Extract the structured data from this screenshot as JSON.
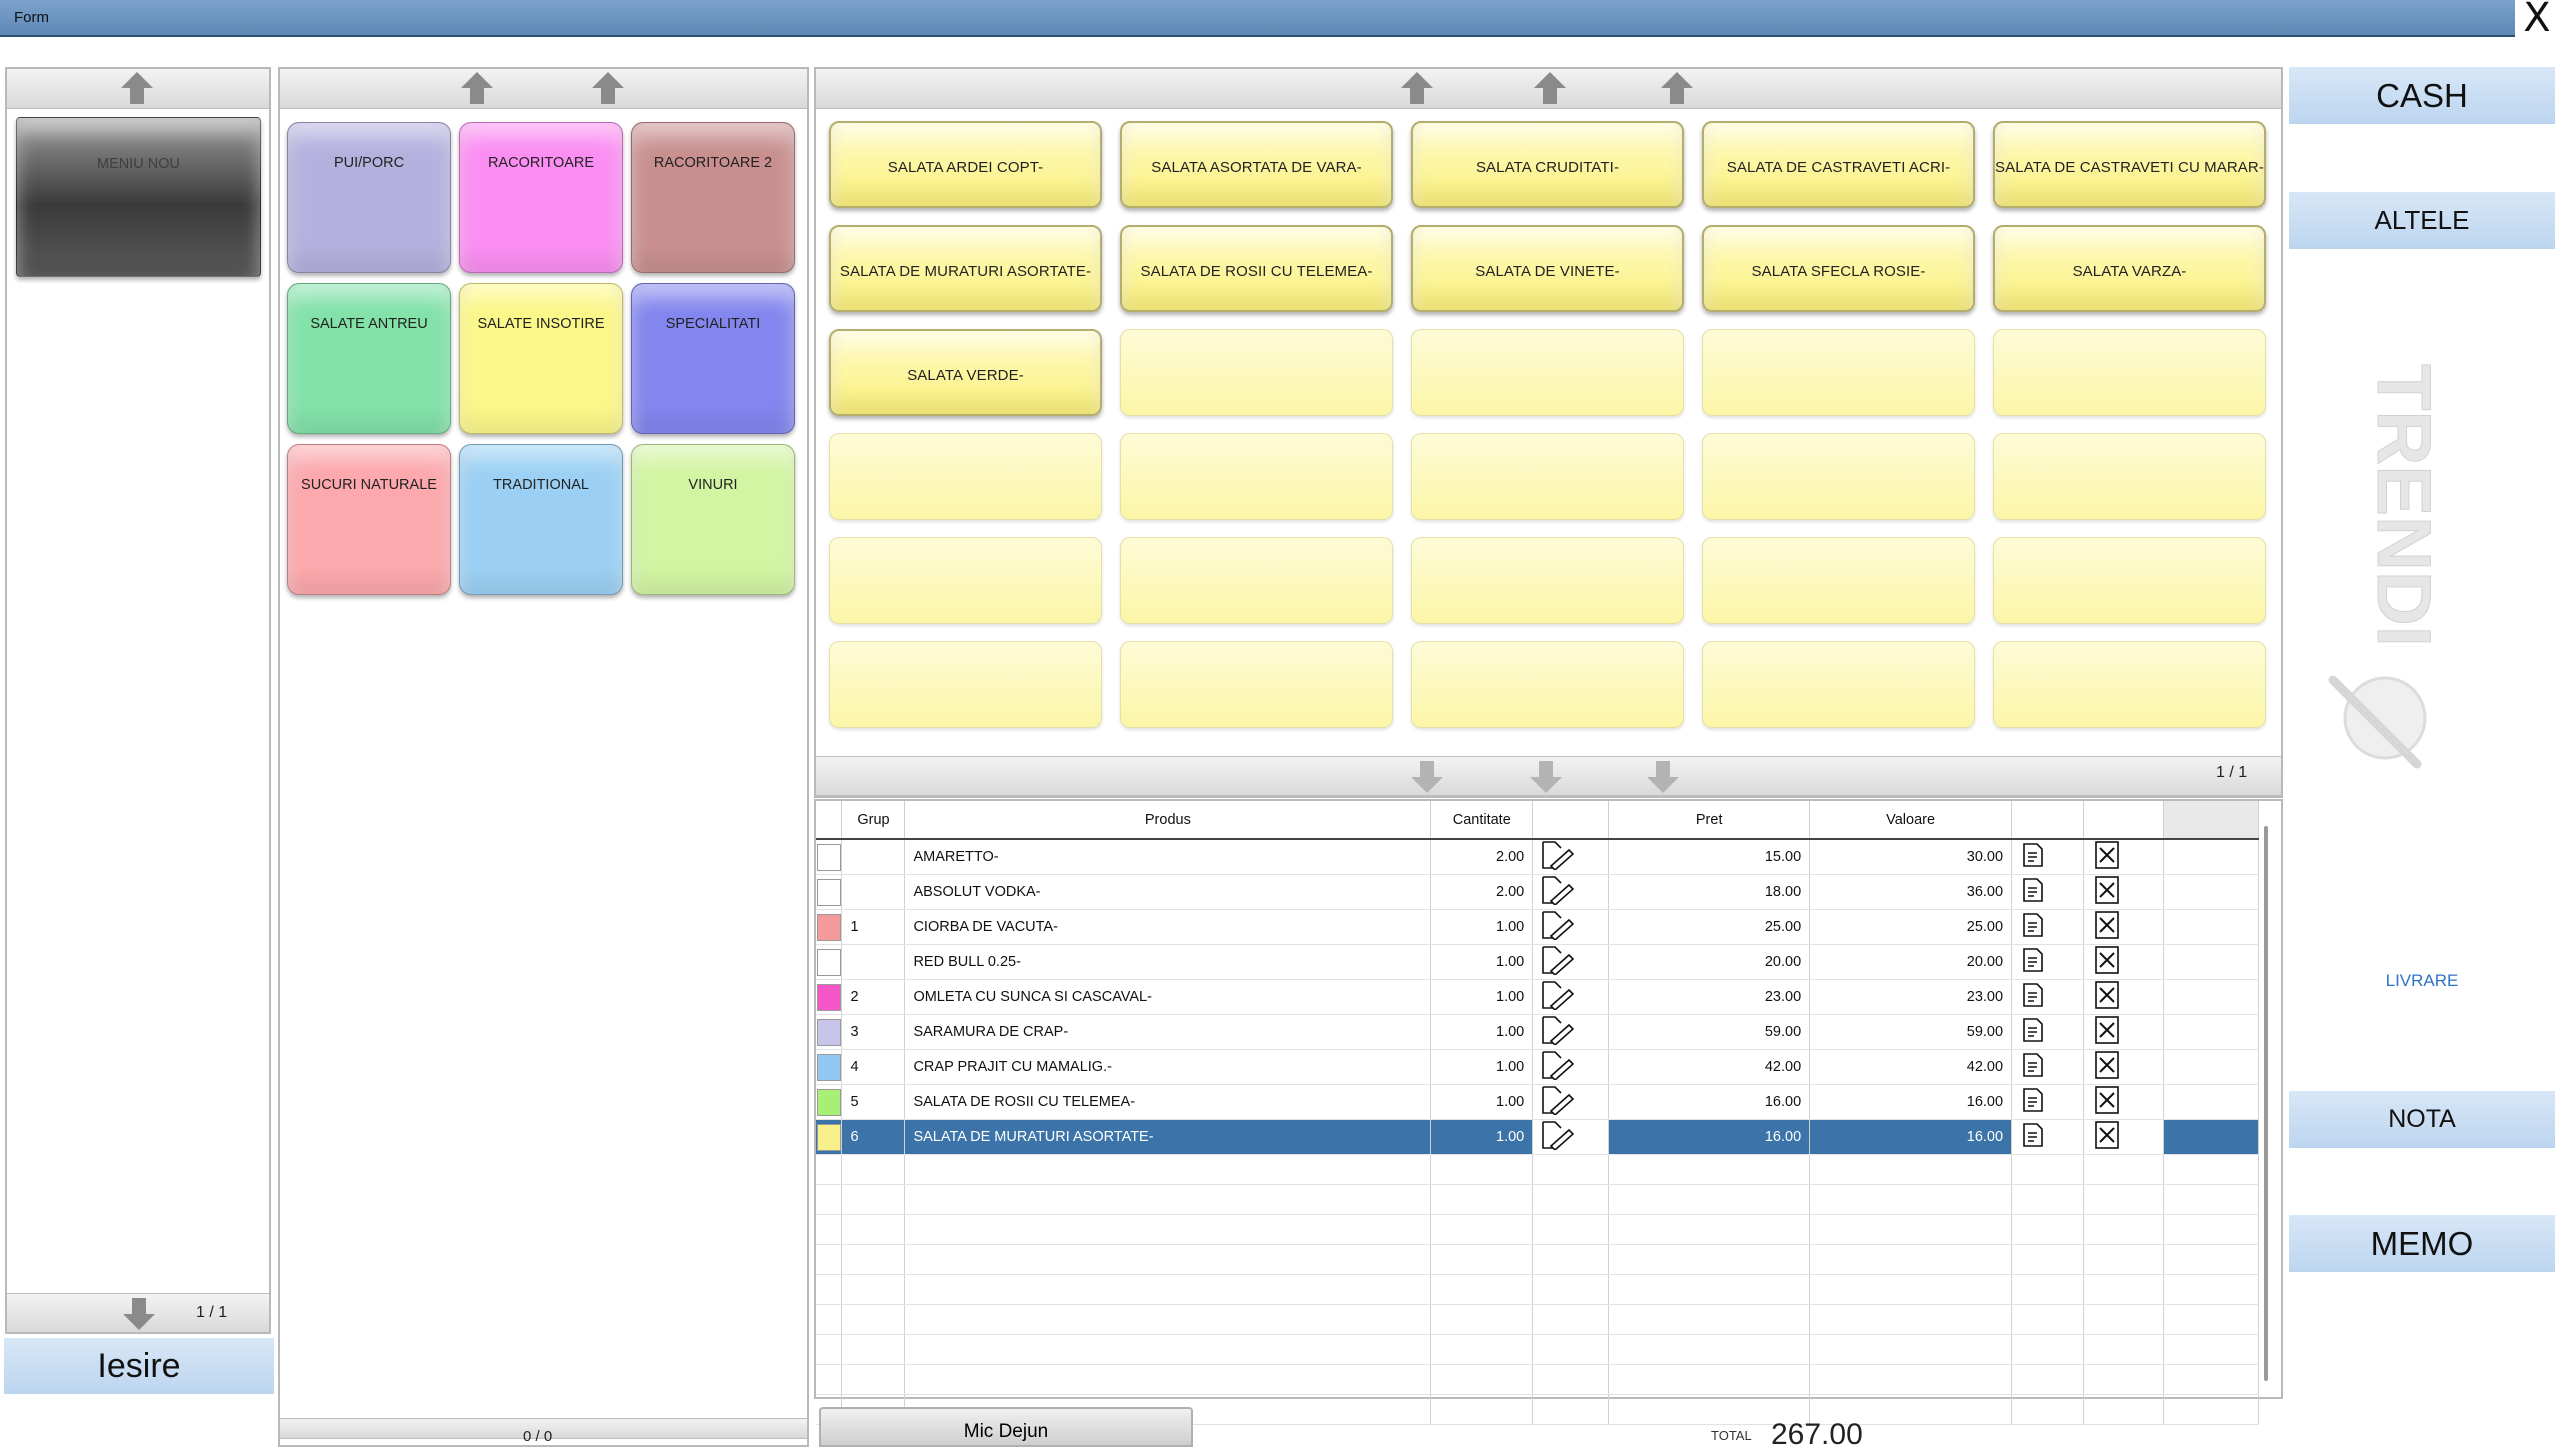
{
  "window": {
    "title": "Form",
    "close_label": "X"
  },
  "menus": {
    "items": [
      {
        "label": "MENIU NOU",
        "color": "#4a4a4a"
      }
    ],
    "page": "1 / 1",
    "exit_label": "Iesire"
  },
  "groups": {
    "items": [
      {
        "label": "PUI/PORC",
        "color": "#b4b1de"
      },
      {
        "label": "RACORITOARE",
        "color": "#fb8ef2"
      },
      {
        "label": "RACORITOARE 2",
        "color": "#c98f8f"
      },
      {
        "label": "SALATE ANTREU",
        "color": "#82e2a8"
      },
      {
        "label": "SALATE INSOTIRE",
        "color": "#fcf789"
      },
      {
        "label": "SPECIALITATI",
        "color": "#8286ee"
      },
      {
        "label": "SUCURI NATURALE",
        "color": "#fca8ac"
      },
      {
        "label": "TRADITIONAL",
        "color": "#9bd0f4"
      },
      {
        "label": "VINURI",
        "color": "#d2f5a3"
      }
    ],
    "page": "0 / 0"
  },
  "products": {
    "items": [
      "SALATA ARDEI COPT-",
      "SALATA ASORTATA DE VARA-",
      "SALATA CRUDITATI-",
      "SALATA DE CASTRAVETI ACRI-",
      "SALATA DE CASTRAVETI CU MARAR-",
      "SALATA DE MURATURI ASORTATE-",
      "SALATA DE ROSII CU TELEMEA-",
      "SALATA DE VINETE-",
      "SALATA SFECLA ROSIE-",
      "SALATA VARZA-",
      "SALATA VERDE-"
    ],
    "empty_slots": 19,
    "page": "1 / 1"
  },
  "order": {
    "columns": {
      "grup": "Grup",
      "produs": "Produs",
      "cantitate": "Cantitate",
      "pret": "Pret",
      "valoare": "Valoare"
    },
    "rows": [
      {
        "color": "#ffffff",
        "grup": "",
        "produs": "AMARETTO-",
        "cantitate": "2.00",
        "pret": "15.00",
        "valoare": "30.00"
      },
      {
        "color": "#ffffff",
        "grup": "",
        "produs": "ABSOLUT VODKA-",
        "cantitate": "2.00",
        "pret": "18.00",
        "valoare": "36.00"
      },
      {
        "color": "#f49a9a",
        "grup": "1",
        "produs": "CIORBA DE VACUTA-",
        "cantitate": "1.00",
        "pret": "25.00",
        "valoare": "25.00"
      },
      {
        "color": "#ffffff",
        "grup": "",
        "produs": "RED BULL 0.25-",
        "cantitate": "1.00",
        "pret": "20.00",
        "valoare": "20.00"
      },
      {
        "color": "#f456c7",
        "grup": "2",
        "produs": "OMLETA CU SUNCA SI CASCAVAL-",
        "cantitate": "1.00",
        "pret": "23.00",
        "valoare": "23.00"
      },
      {
        "color": "#c7c5ea",
        "grup": "3",
        "produs": "SARAMURA DE CRAP-",
        "cantitate": "1.00",
        "pret": "59.00",
        "valoare": "59.00"
      },
      {
        "color": "#93c6f2",
        "grup": "4",
        "produs": "CRAP PRAJIT CU MAMALIG.-",
        "cantitate": "1.00",
        "pret": "42.00",
        "valoare": "42.00"
      },
      {
        "color": "#a8ef76",
        "grup": "5",
        "produs": "SALATA DE ROSII CU TELEMEA-",
        "cantitate": "1.00",
        "pret": "16.00",
        "valoare": "16.00"
      },
      {
        "color": "#f8f08a",
        "grup": "6",
        "produs": "SALATA DE MURATURI ASORTATE-",
        "cantitate": "1.00",
        "pret": "16.00",
        "valoare": "16.00",
        "selected": true
      }
    ],
    "empty_rows": 9
  },
  "footer": {
    "meal_label": "Mic Dejun",
    "total_label": "TOTAL",
    "total_value": "267.00"
  },
  "actions": {
    "cash": "CASH",
    "altele": "ALTELE",
    "livrare": "LIVRARE",
    "nota": "NOTA",
    "memo": "MEMO"
  },
  "brand": {
    "logo_text": "TRENDI",
    "icon": "trendi-logo"
  },
  "icons": {
    "scroll_up": "arrow-up-icon",
    "scroll_down": "arrow-down-icon",
    "edit": "edit-note-icon",
    "delete": "delete-x-icon"
  }
}
